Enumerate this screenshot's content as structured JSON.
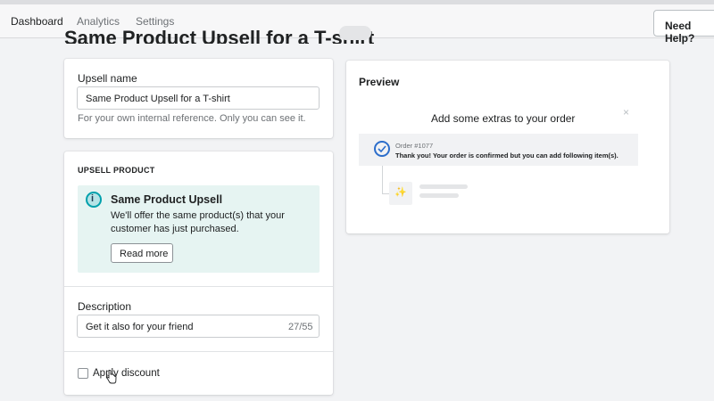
{
  "nav": {
    "items": [
      {
        "label": "Dashboard"
      },
      {
        "label": "Analytics"
      },
      {
        "label": "Settings"
      }
    ],
    "help_label": "Need Help?"
  },
  "page": {
    "title": "Same Product Upsell for a T-shirt"
  },
  "name_card": {
    "label": "Upsell name",
    "value": "Same Product Upsell for a T-shirt",
    "help": "For your own internal reference. Only you can see it."
  },
  "product_card": {
    "heading": "UPSELL PRODUCT",
    "banner": {
      "title": "Same Product Upsell",
      "body": "We'll offer the same product(s) that your customer has just purchased.",
      "button": "Read more"
    },
    "description": {
      "label": "Description",
      "value": "Get it also for your friend",
      "counter": "27/55"
    },
    "discount": {
      "label": "Apply discount",
      "checked": false
    }
  },
  "preview": {
    "title": "Preview",
    "heading": "Add some extras to your order",
    "close": "×",
    "order_number": "Order #1077",
    "order_message": "Thank you! Your order is confirmed but you can add following item(s).",
    "product_icon": "magic-wand-icon"
  },
  "colors": {
    "banner_bg": "#e6f4f2",
    "info_accent": "#00a0ac",
    "check_blue": "#2c6ecb"
  }
}
